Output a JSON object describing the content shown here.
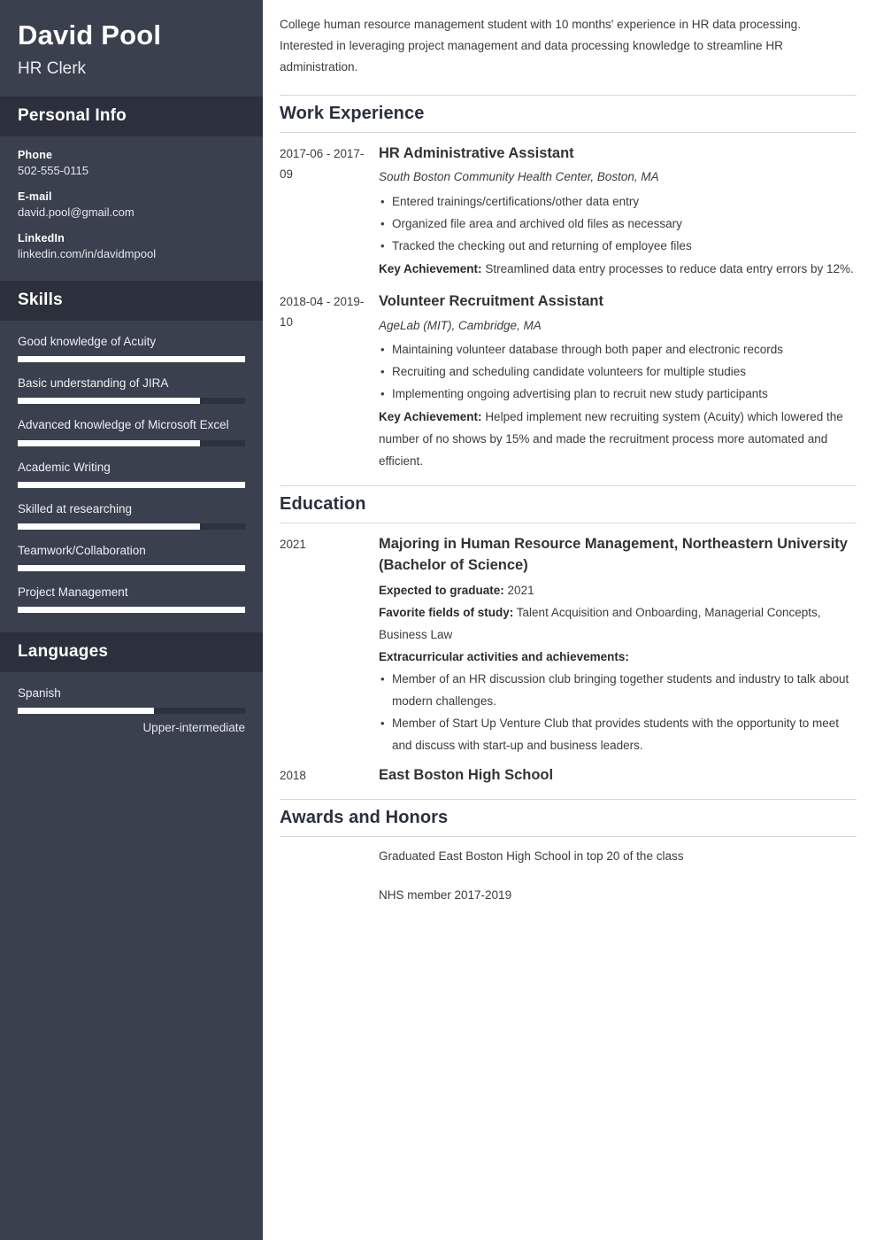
{
  "sidebar": {
    "name": "David Pool",
    "job_title": "HR Clerk",
    "personal_info": {
      "heading": "Personal Info",
      "items": [
        {
          "label": "Phone",
          "value": "502-555-0115"
        },
        {
          "label": "E-mail",
          "value": "david.pool@gmail.com"
        },
        {
          "label": "LinkedIn",
          "value": "linkedin.com/in/davidmpool"
        }
      ]
    },
    "skills": {
      "heading": "Skills",
      "items": [
        {
          "name": "Good knowledge of Acuity",
          "level": 100
        },
        {
          "name": "Basic understanding of JIRA",
          "level": 80
        },
        {
          "name": "Advanced knowledge of Microsoft Excel",
          "level": 80
        },
        {
          "name": "Academic Writing",
          "level": 100
        },
        {
          "name": "Skilled at researching",
          "level": 80
        },
        {
          "name": "Teamwork/Collaboration",
          "level": 100
        },
        {
          "name": "Project Management",
          "level": 100
        }
      ]
    },
    "languages": {
      "heading": "Languages",
      "items": [
        {
          "name": "Spanish",
          "level": 60,
          "proficiency": "Upper-intermediate"
        }
      ]
    }
  },
  "main": {
    "summary": "College human resource management student with 10 months' experience in HR data processing. Interested in leveraging project management and data processing knowledge to streamline HR administration.",
    "work_experience": {
      "heading": "Work Experience",
      "entries": [
        {
          "date": "2017-06 - 2017-09",
          "title": "HR Administrative Assistant",
          "organization": "South Boston Community Health Center, Boston, MA",
          "bullets": [
            "Entered trainings/certifications/other data entry",
            "Organized file area and archived old files as necessary",
            "Tracked the checking out and returning of employee files"
          ],
          "achievement_label": "Key Achievement:",
          "achievement_text": "Streamlined data entry processes to reduce data entry errors by 12%."
        },
        {
          "date": "2018-04 - 2019-10",
          "title": "Volunteer Recruitment Assistant",
          "organization": "AgeLab (MIT), Cambridge, MA",
          "bullets": [
            "Maintaining volunteer database through both paper and electronic records",
            "Recruiting and scheduling candidate volunteers for multiple studies",
            "Implementing ongoing advertising plan to recruit new study participants"
          ],
          "achievement_label": "Key Achievement:",
          "achievement_text": "Helped implement new recruiting system (Acuity) which lowered the number of no shows by 15% and made the recruitment process more automated and efficient."
        }
      ]
    },
    "education": {
      "heading": "Education",
      "entries": [
        {
          "date": "2021",
          "title": "Majoring in Human Resource Management, Northeastern University (Bachelor of Science)",
          "graduate_label": "Expected to graduate:",
          "graduate_value": "2021",
          "fields_label": "Favorite fields of study:",
          "fields_value": "Talent Acquisition and Onboarding, Managerial Concepts, Business Law",
          "extracurricular_label": "Extracurricular activities and achievements:",
          "bullets": [
            "Member of an HR discussion club bringing together students and industry to talk about modern challenges.",
            "Member of Start Up Venture Club that provides students with the opportunity to meet and discuss with start-up and business leaders."
          ]
        },
        {
          "date": "2018",
          "title": "East Boston High School"
        }
      ]
    },
    "awards": {
      "heading": "Awards and Honors",
      "items": [
        "Graduated East Boston High School in top 20 of the class",
        "NHS member 2017-2019"
      ]
    }
  }
}
